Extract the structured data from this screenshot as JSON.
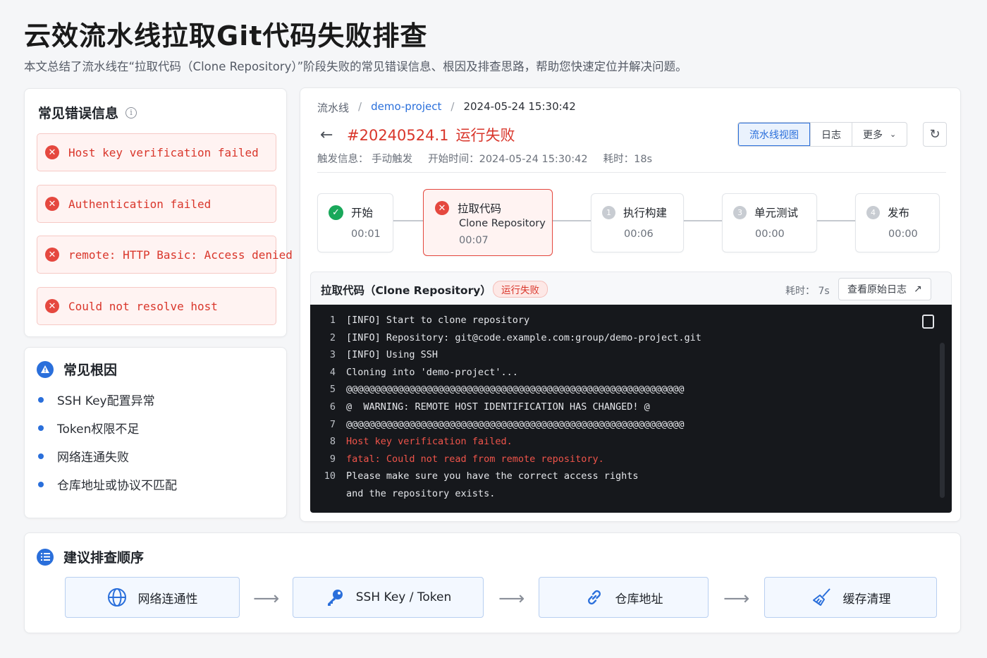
{
  "page": {
    "title": "云效流水线拉取Git代码失败排查",
    "description": "本文总结了流水线在“拉取代码（Clone Repository）”阶段失败的常见错误信息、根因及排查思路，帮助您快速定位并解决问题。"
  },
  "errors": {
    "heading": "常见错误信息",
    "items": [
      "Host key verification failed",
      "Authentication failed",
      "remote: HTTP Basic: Access denied",
      "Could not resolve host"
    ]
  },
  "causes": {
    "heading": "常见根因",
    "items": [
      "SSH Key配置异常",
      "Token权限不足",
      "网络连通失败",
      "仓库地址或协议不匹配"
    ]
  },
  "pipeline": {
    "breadcrumb": [
      "流水线",
      "demo-project",
      "2024-05-24 15:30:42"
    ],
    "run_id": "#20240524.1",
    "run_status": "运行失败",
    "meta": {
      "trigger": "触发信息： 手动触发",
      "start": "开始时间：2024-05-24 15:30:42",
      "duration": "耗时：18s"
    },
    "tabs": [
      "流水线视图",
      "日志",
      "更多"
    ],
    "stages": [
      {
        "name": "开始",
        "time": "00:01",
        "status": "success"
      },
      {
        "name": "拉取代码",
        "subtitle": "Clone Repository",
        "time": "00:07",
        "status": "failed"
      },
      {
        "name": "执行构建",
        "time": "00:06",
        "status": "pending",
        "index": "1"
      },
      {
        "name": "单元测试",
        "time": "00:00",
        "status": "pending",
        "index": "3"
      },
      {
        "name": "发布",
        "time": "00:00",
        "status": "pending",
        "index": "4"
      }
    ],
    "log": {
      "title": "拉取代码（Clone Repository）",
      "status": "运行失败",
      "duration": "耗时： 7s",
      "raw_button": "查看原始日志",
      "lines": [
        {
          "n": "1",
          "text": "[INFO] Start to clone repository",
          "error": false
        },
        {
          "n": "2",
          "text": "[INFO] Repository: git@code.example.com:group/demo-project.git",
          "error": false
        },
        {
          "n": "3",
          "text": "[INFO] Using SSH",
          "error": false
        },
        {
          "n": "4",
          "text": "Cloning into 'demo-project'...",
          "error": false
        },
        {
          "n": "5",
          "text": "@@@@@@@@@@@@@@@@@@@@@@@@@@@@@@@@@@@@@@@@@@@@@@@@@@@@@@@@@@@",
          "error": false
        },
        {
          "n": "6",
          "text": "@  WARNING: REMOTE HOST IDENTIFICATION HAS CHANGED! @",
          "error": false
        },
        {
          "n": "7",
          "text": "@@@@@@@@@@@@@@@@@@@@@@@@@@@@@@@@@@@@@@@@@@@@@@@@@@@@@@@@@@@",
          "error": false
        },
        {
          "n": "8",
          "text": "Host key verification failed.",
          "error": true
        },
        {
          "n": "9",
          "text": "fatal: Could not read from remote repository.",
          "error": true
        },
        {
          "n": "10",
          "text": "Please make sure you have the correct access rights",
          "error": false
        },
        {
          "n": "",
          "text": "and the repository exists.",
          "error": false
        }
      ]
    }
  },
  "steps": {
    "heading": "建议排查顺序",
    "items": [
      {
        "label": "网络连通性",
        "icon": "globe-icon"
      },
      {
        "label": "SSH Key / Token",
        "icon": "key-icon"
      },
      {
        "label": "仓库地址",
        "icon": "link-icon"
      },
      {
        "label": "缓存清理",
        "icon": "broom-icon"
      }
    ]
  },
  "colors": {
    "accent": "#2a6fdb",
    "error": "#d9362b",
    "success": "#19a85a",
    "console_bg": "#16181c"
  }
}
